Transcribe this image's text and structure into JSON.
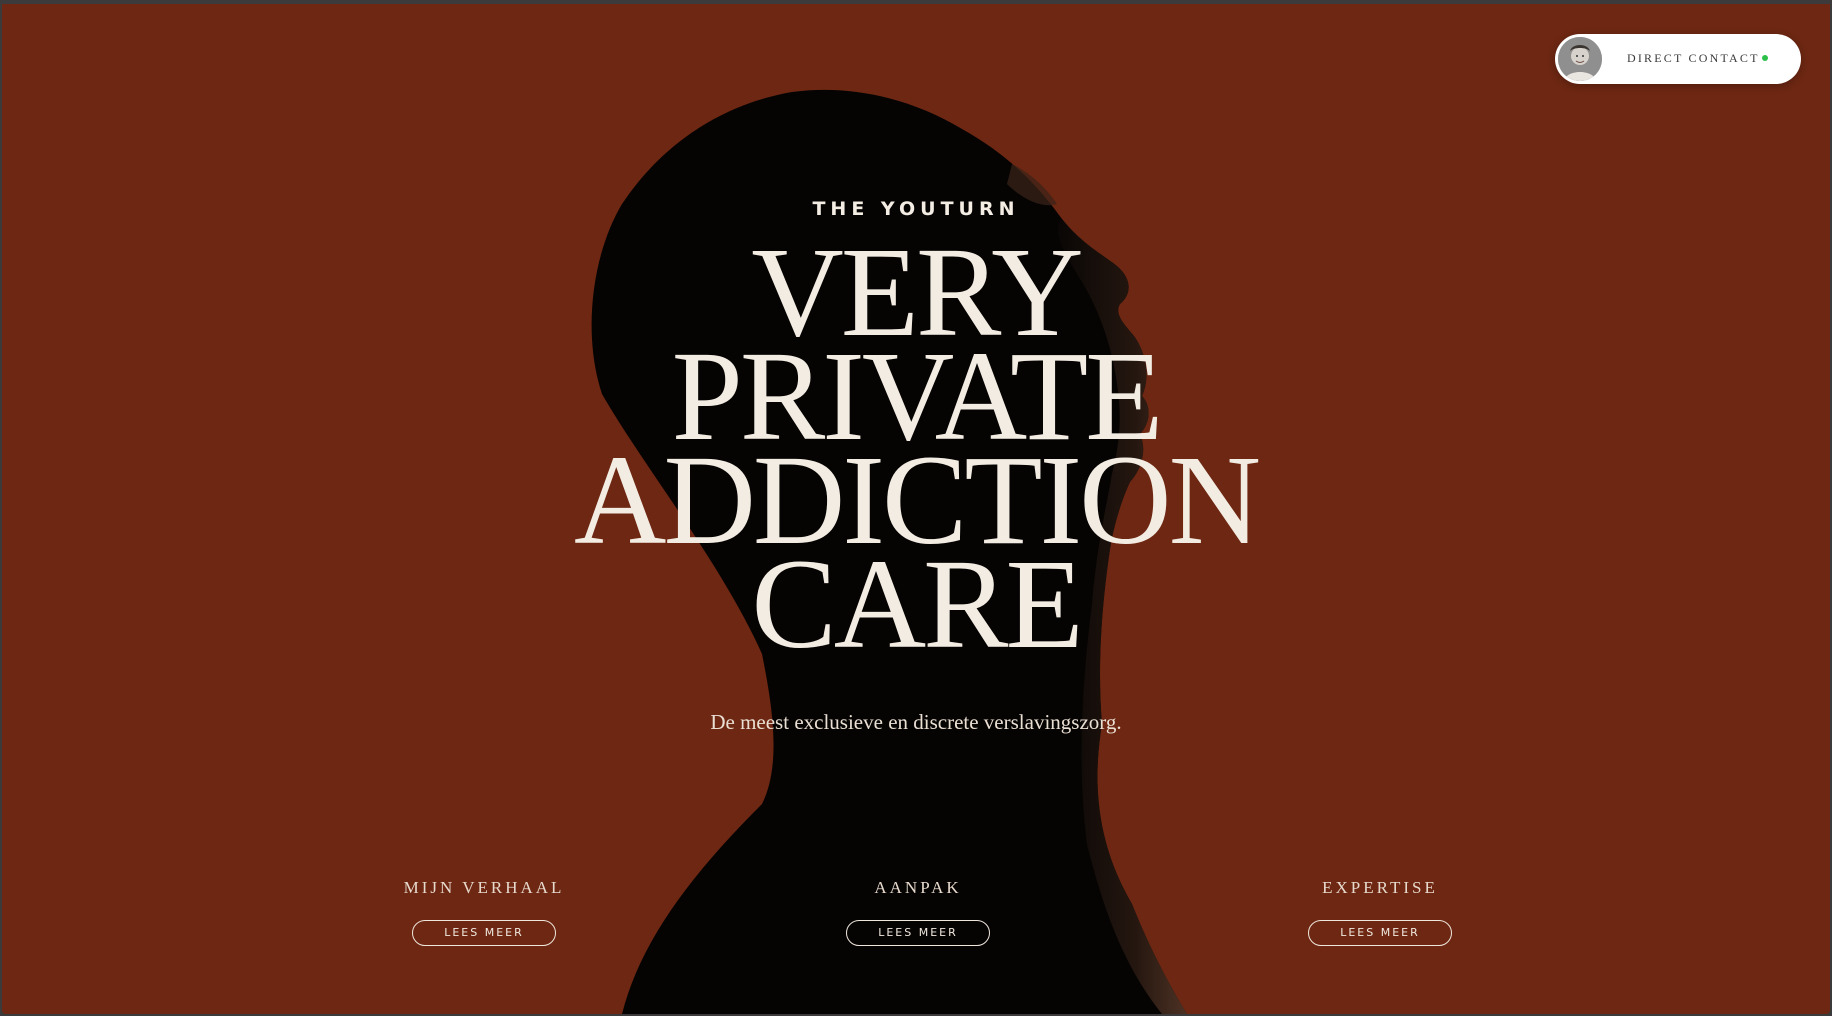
{
  "brand": {
    "name": "THE YOUTURN"
  },
  "hero": {
    "headline_lines": [
      "VERY",
      "PRIVATE",
      "ADDICTION",
      "CARE"
    ],
    "subtitle": "De meest exclusieve en discrete verslavingszorg."
  },
  "contact": {
    "label": "DIRECT CONTACT",
    "status": "online",
    "status_color": "#2cc04a"
  },
  "sections": [
    {
      "title": "MIJN VERHAAL",
      "button": "LEES MEER"
    },
    {
      "title": "AANPAK",
      "button": "LEES MEER"
    },
    {
      "title": "EXPERTISE",
      "button": "LEES MEER"
    }
  ],
  "colors": {
    "background": "#6d2712",
    "text": "#f3ece2",
    "silhouette": "#050403"
  }
}
